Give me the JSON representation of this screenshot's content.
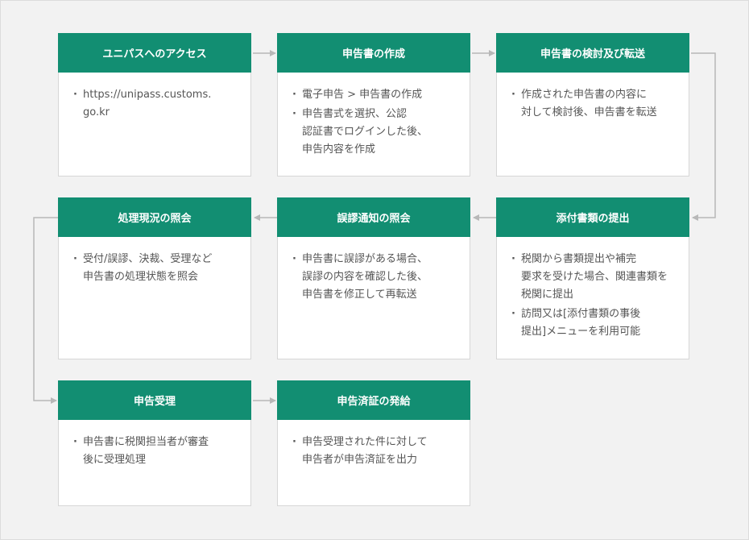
{
  "colors": {
    "header_bg": "#128e72",
    "header_text": "#ffffff",
    "connector": "#b8b8b8",
    "panel_bg": "#f2f2f2"
  },
  "steps": [
    {
      "title": "ユニパスへのアクセス",
      "items": [
        "https://unipass.customs.\ngo.kr"
      ]
    },
    {
      "title": "申告書の作成",
      "items": [
        "電子申告 > 申告書の作成",
        "申告書式を選択、公認\n認証書でログインした後、\n申告内容を作成"
      ]
    },
    {
      "title": "申告書の検討及び転送",
      "items": [
        "作成された申告書の内容に\n対して検討後、申告書を転送"
      ]
    },
    {
      "title": "添付書類の提出",
      "items": [
        "税関から書類提出や補完\n要求を受けた場合、関連書類を\n税関に提出",
        "訪問又は[添付書類の事後\n提出]メニューを利用可能"
      ]
    },
    {
      "title": "誤謬通知の照会",
      "items": [
        " 申告書に誤謬がある場合、\n誤謬の内容を確認した後、\n申告書を修正して再転送"
      ]
    },
    {
      "title": "処理現況の照会",
      "items": [
        "受付/誤謬、決裁、受理など\n申告書の処理状態を照会"
      ]
    },
    {
      "title": "申告受理",
      "items": [
        "申告書に税関担当者が審査\n後に受理処理"
      ]
    },
    {
      "title": "申告済証の発給",
      "items": [
        "申告受理された件に対して\n申告者が申告済証を出力"
      ]
    }
  ]
}
